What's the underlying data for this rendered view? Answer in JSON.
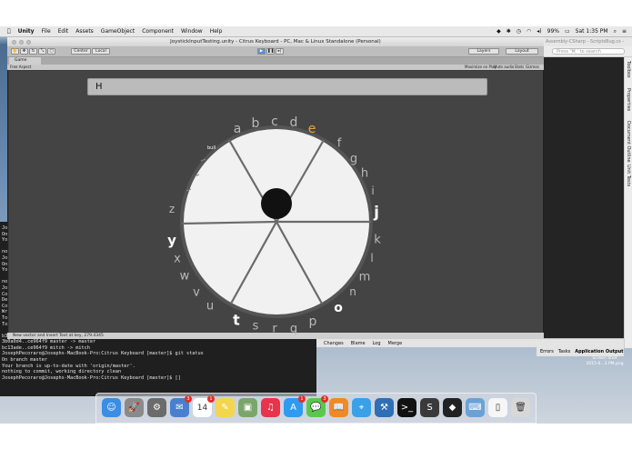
{
  "menubar": {
    "app": "Unity",
    "items": [
      "File",
      "Edit",
      "Assets",
      "GameObject",
      "Component",
      "Window",
      "Help"
    ],
    "battery": "99%",
    "clock": "Sat 1:35 PM"
  },
  "monodevelop": {
    "title": "Assembly-CSharp - ScriptsBug.cs - MonoDevelop-Unity",
    "search_placeholder": "Press '⌘.' to search",
    "side_tabs": [
      "Toolbox",
      "Properties",
      "Document Outline",
      "Unit Tests"
    ],
    "bottom_tabs": [
      "Changes",
      "Blame",
      "Log",
      "Merge"
    ],
    "bottom_right": [
      "Errors",
      "Tasks",
      "Application Output"
    ],
    "desktop_labels": [
      "Screen Shot",
      "2015-0...3 PM.png"
    ]
  },
  "unity": {
    "title": "JoystickInputTesting.unity - Citrus Keyboard - PC, Mac & Linux Standalone (Personal)",
    "center_label": "Center",
    "local_label": "Local",
    "layers_label": "Layers",
    "layout_label": "Layout",
    "game_tab": "Game",
    "aspect": "Free Aspect",
    "options": [
      "Maximize on Play",
      "Mute audio",
      "Stats",
      "Gizmos"
    ],
    "status": "New vector and Insert Text at key, 279.4345",
    "input_text": "H",
    "small_label": "bull"
  },
  "wheel_letters": [
    "a",
    "b",
    "c",
    "d",
    "e",
    "f",
    "g",
    "h",
    "i",
    "j",
    "k",
    "l",
    "m",
    "n",
    "o",
    "p",
    "q",
    "r",
    "s",
    "t",
    "u",
    "v",
    "w",
    "x",
    "y",
    "z"
  ],
  "highlight_letter": "e",
  "terminal": {
    "lines": [
      "Jo",
      "On",
      "Yo",
      "",
      "no",
      "Jo",
      "On",
      "Yo",
      "",
      "no",
      "Jo",
      "Co",
      "De",
      "Co",
      "Wr",
      "To",
      "To",
      "",
      "   b33beb0..98d1f6c  glow -> glow",
      "   3b0a0d4..ce964f9  master -> master",
      "   bc13ade..ce964f9  mitch -> mitch",
      "JosephPecoraro@Josephs-MacBook-Pro:Citrus Keyboard [master]$ git status",
      "On branch master",
      "Your branch is up-to-date with 'origin/master'.",
      "nothing to commit, working directory clean",
      "JosephPecoraro@Josephs-MacBook-Pro:Citrus Keyboard [master]$ []"
    ]
  },
  "dock": {
    "icons": [
      "finder-icon",
      "launchpad-icon",
      "system-preferences-icon",
      "mail-icon",
      "calendar-icon",
      "notes-icon",
      "preview-icon",
      "itunes-icon",
      "app-store-icon",
      "messages-icon",
      "ibooks-icon",
      "safari-icon",
      "xcode-icon",
      "terminal-icon",
      "sublime-icon",
      "unity-icon",
      "monodevelop-icon",
      "documents-icon",
      "trash-icon"
    ],
    "calendar_day": "14",
    "mail_badge": "3",
    "calendar_badge": "1",
    "messages_badge": "3",
    "store_badge": "1"
  }
}
